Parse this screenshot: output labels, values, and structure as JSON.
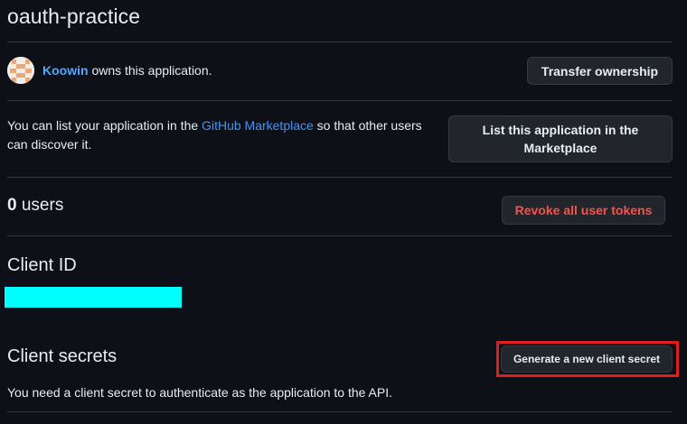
{
  "app": {
    "title": "oauth-practice"
  },
  "owner": {
    "avatar_icon": "identicon-avatar",
    "name": "Koowin",
    "suffix": "owns this application.",
    "transfer_button": "Transfer ownership"
  },
  "marketplace": {
    "text_before": "You can list your application in the ",
    "link": "GitHub Marketplace",
    "text_after": " so that other users can discover it.",
    "button": "List this application in the Marketplace"
  },
  "users": {
    "count": "0",
    "label": "users",
    "revoke_button": "Revoke all user tokens"
  },
  "client_id": {
    "title": "Client ID"
  },
  "client_secrets": {
    "title": "Client secrets",
    "generate_button": "Generate a new client secret",
    "description": "You need a client secret to authenticate as the application to the API."
  },
  "colors": {
    "background": "#0d1117",
    "text": "#e6edf3",
    "link": "#4493f8",
    "danger": "#f85149",
    "button_bg": "#21262d",
    "divider": "#30363d",
    "redaction": "#00ffff",
    "highlight": "#e11d1d"
  }
}
